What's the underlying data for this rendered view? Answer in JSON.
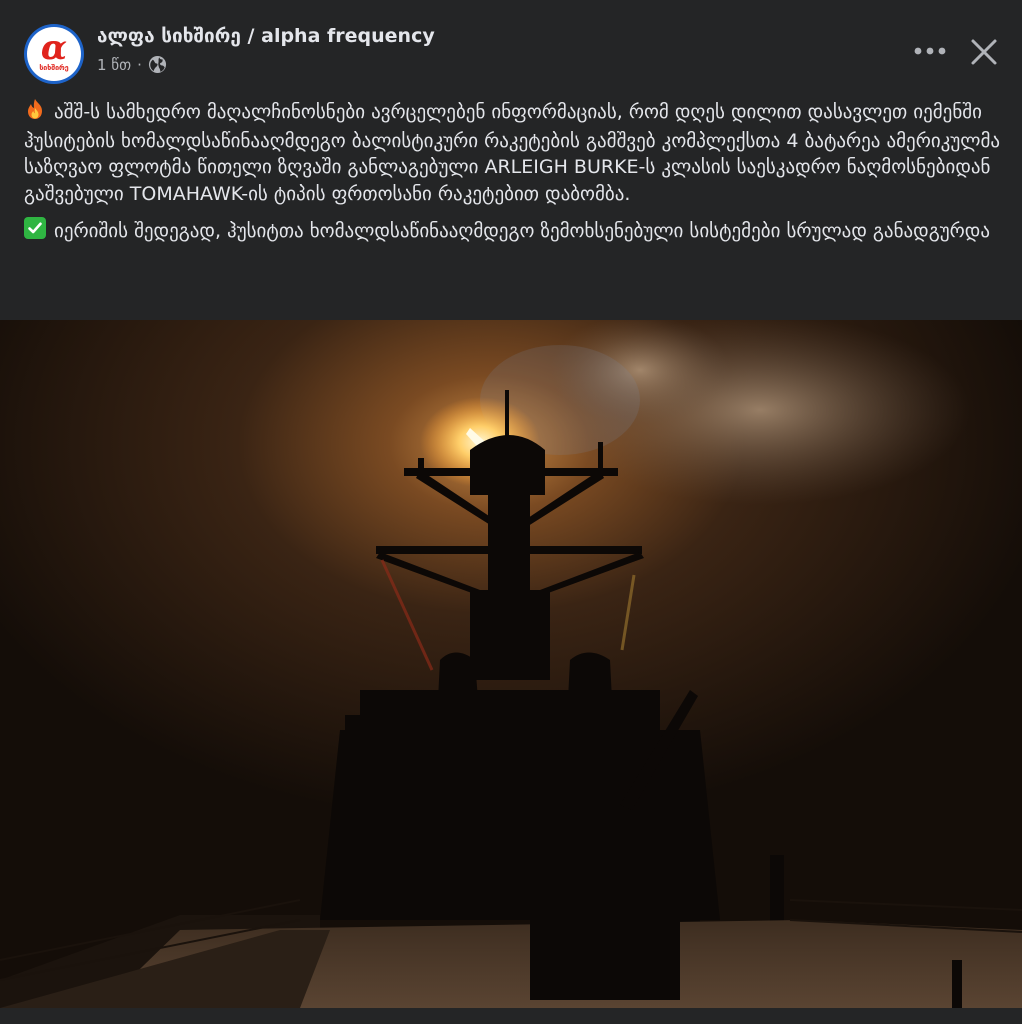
{
  "post": {
    "page_name": "ალფა სიხშირე / alpha frequency",
    "timestamp": "1 წთ",
    "separator": "·",
    "visibility_icon": "globe-icon",
    "more_icon": "more-horizontal-icon",
    "close_icon": "close-icon",
    "avatar": {
      "symbol": "α",
      "text": "სიხშირე",
      "ring_color": "#1d63c9",
      "accent_color": "#e0231c"
    }
  },
  "content": {
    "paragraph1": {
      "emoji": "fire-emoji",
      "text": "აშშ-ს სამხედრო მაღალჩინოსნები ავრცელებენ ინფორმაციას, რომ დღეს დილით დასავლეთ იემენში  ჰუსიტების ხომალდსაწინააღმდეგო ბალისტიკური რაკეტების გამშვებ კომპლექსთა 4 ბატარეა  ამერიკულმა საზღვაო ფლოტმა წითელი ზღვაში განლაგებული ARLEIGH BURKE-ს კლასის საესკადრო ნაღმოსნებიდან  გაშვებული TOMAHAWK-ის ტიპის ფრთოსანი რაკეტებით დაბომბა."
    },
    "paragraph2": {
      "emoji": "check-mark-emoji",
      "text": "იერიშის შედეგად, ჰუსიტთა ხომალდსაწინააღმდეგო ზემოხსენებული სისტემები სრულად განადგურდა"
    }
  },
  "photo": {
    "description_icon": "warship-night-launch-photo"
  },
  "colors": {
    "background": "#242526",
    "text_primary": "#e4e6eb",
    "text_secondary": "#b0b3b8"
  }
}
